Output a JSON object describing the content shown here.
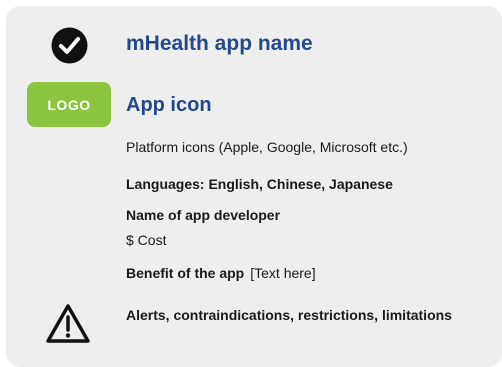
{
  "header": {
    "app_name": "mHealth app name"
  },
  "logo": {
    "label": "LOGO",
    "color": "#8cc43f"
  },
  "icons": {
    "check": "check-circle-icon",
    "warning": "warning-triangle-icon"
  },
  "app_icon": {
    "title": "App icon"
  },
  "details": {
    "platform": "Platform icons (Apple, Google, Microsoft etc.)",
    "languages": "Languages: English, Chinese, Japanese",
    "developer": "Name of app developer",
    "cost": "$ Cost",
    "benefit_label": "Benefit of the app",
    "benefit_value": "[Text here]",
    "alerts": "Alerts, contraindications, restrictions, limitations"
  },
  "colors": {
    "title": "#24498a",
    "card_background": "#eeeeef"
  }
}
